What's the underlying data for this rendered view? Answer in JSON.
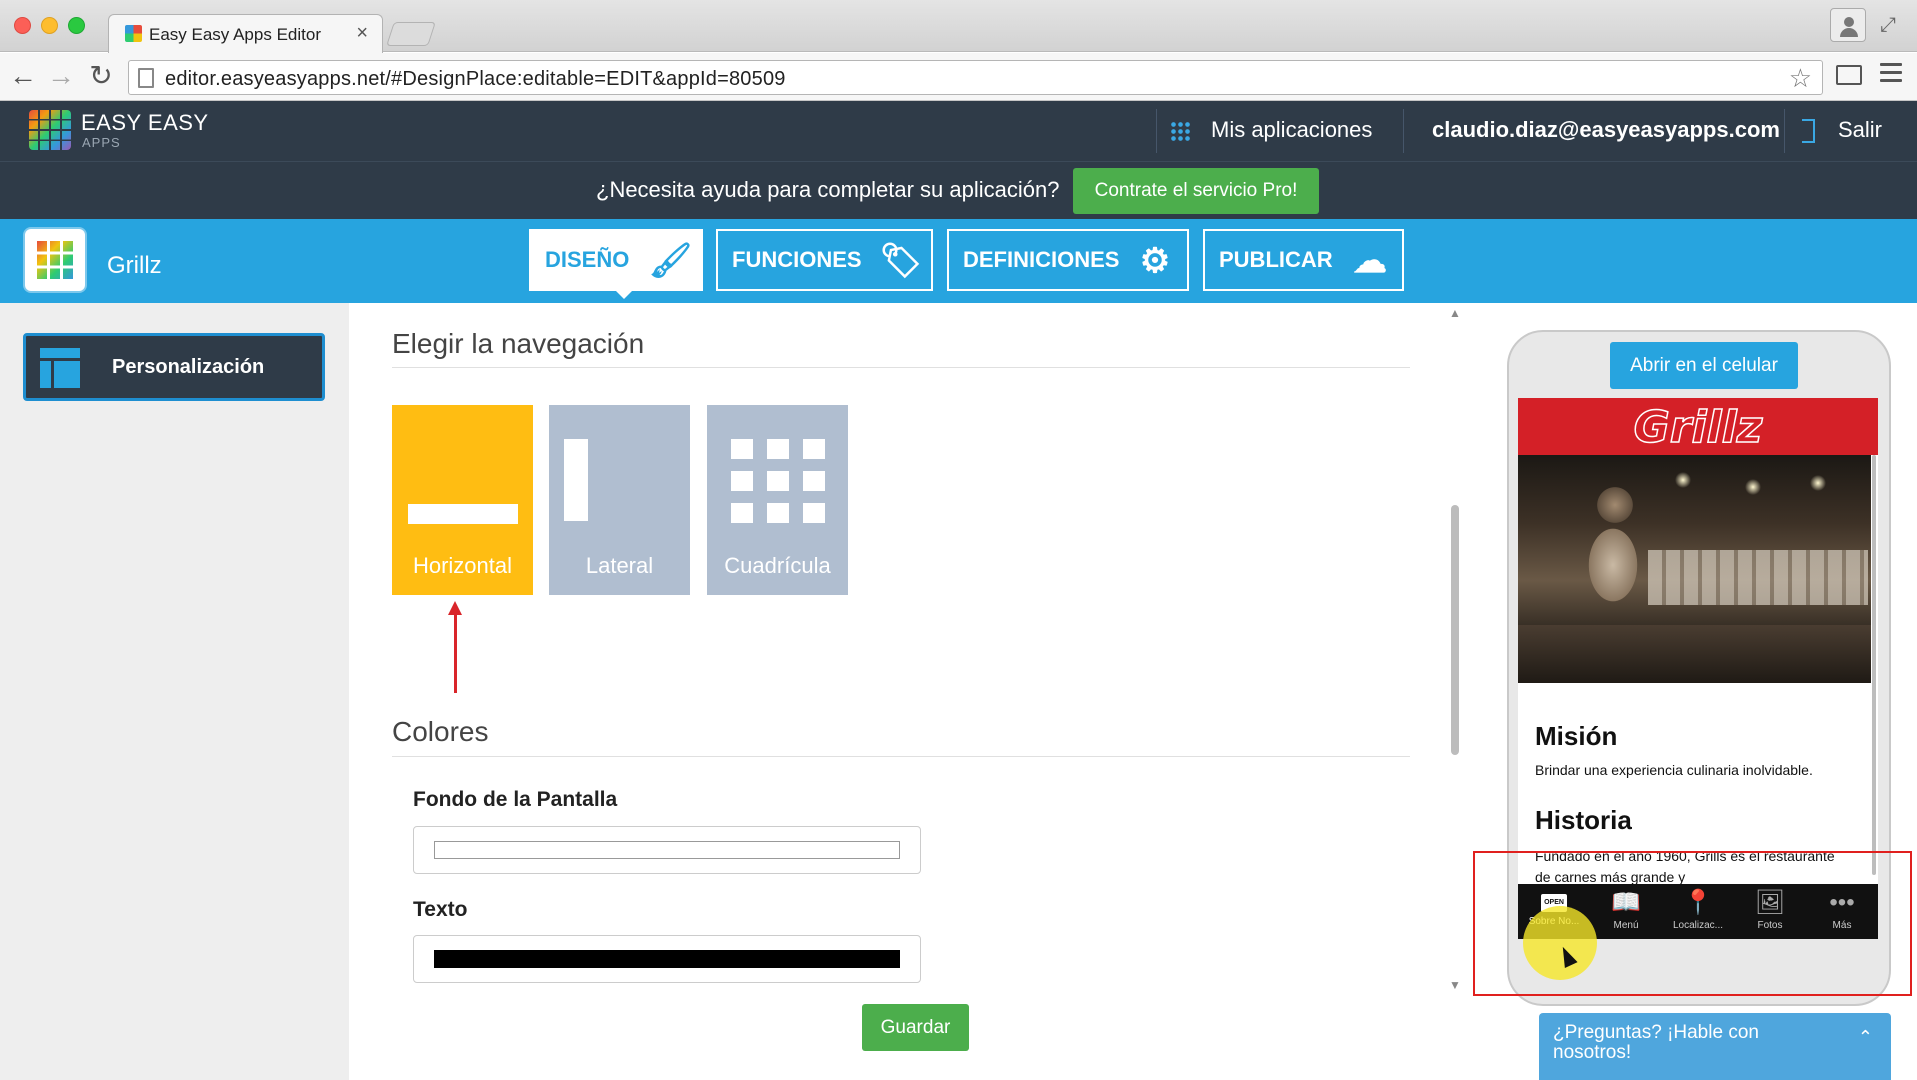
{
  "browser": {
    "tab_title": "Easy Easy Apps Editor",
    "tab_close": "×",
    "url": "editor.easyeasyapps.net/#DesignPlace:editable=EDIT&appId=80509",
    "icons": [
      "back-icon",
      "forward-icon",
      "reload-icon",
      "star-icon",
      "cast-icon",
      "menu-icon"
    ]
  },
  "topbar": {
    "brand": "EASY EASY",
    "brand_sub": "APPS",
    "my_apps": "Mis aplicaciones",
    "user_email": "claudio.diaz@easyeasyapps.com",
    "logout": "Salir"
  },
  "helpbar": {
    "text": "¿Necesita ayuda para completar su aplicación?",
    "cta": "Contrate el servicio Pro!"
  },
  "navbar": {
    "app_name": "Grillz",
    "tabs": [
      {
        "label": "DISEÑO",
        "icon": "brush-icon",
        "active": true
      },
      {
        "label": "FUNCIONES",
        "icon": "tag-icon",
        "active": false
      },
      {
        "label": "DEFINICIONES",
        "icon": "gear-icon",
        "active": false
      },
      {
        "label": "PUBLICAR",
        "icon": "cloud-upload-icon",
        "active": false
      }
    ]
  },
  "sidebar": {
    "items": [
      {
        "label": "Personalización",
        "icon": "layout-icon"
      }
    ]
  },
  "main": {
    "nav_section_title": "Elegir la navegación",
    "nav_options": [
      {
        "label": "Horizontal",
        "selected": true
      },
      {
        "label": "Lateral",
        "selected": false
      },
      {
        "label": "Cuadrícula",
        "selected": false
      }
    ],
    "colors_title": "Colores",
    "fields": [
      {
        "label": "Fondo de la Pantalla",
        "value": "#ffffff"
      },
      {
        "label": "Texto",
        "value": "#000000"
      }
    ],
    "save": "Guardar",
    "accent": "#ffbd12"
  },
  "preview": {
    "open_button": "Abrir en el celular",
    "logo": "Grillz",
    "mission_title": "Misión",
    "mission_text": "Brindar una experiencia culinaria inolvidable.",
    "history_title": "Historia",
    "history_text": "Fundado en el año 1960, Grills es el restaurante de carnes más grande y",
    "tabs": [
      {
        "label": "Sobre No...",
        "icon": "open-sign-icon",
        "selected": true,
        "badge": "OPEN"
      },
      {
        "label": "Menú",
        "icon": "book-icon",
        "selected": false
      },
      {
        "label": "Localizac...",
        "icon": "map-pin-icon",
        "selected": false
      },
      {
        "label": "Fotos",
        "icon": "photo-icon",
        "selected": false
      },
      {
        "label": "Más",
        "icon": "more-icon",
        "selected": false
      }
    ]
  },
  "chat": {
    "text": "¿Preguntas? ¡Hable con nosotros!"
  }
}
